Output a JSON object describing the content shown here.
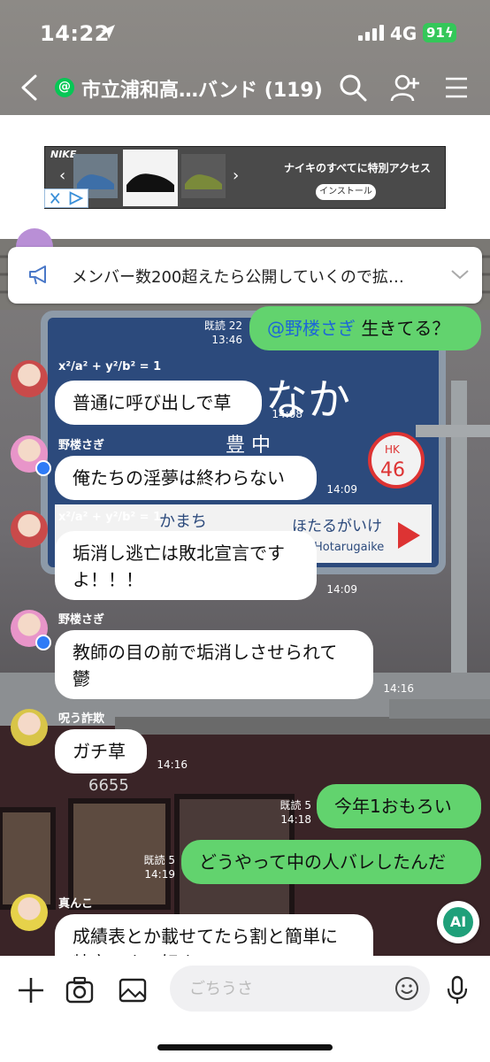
{
  "status": {
    "time": "14:22",
    "network": "4G",
    "battery": "91"
  },
  "header": {
    "group_badge": "@",
    "title": "市立浦和高…バンド (119)"
  },
  "ad": {
    "brand": "NIKE",
    "title": "ナイキのすべてに特別アクセス",
    "install_label": "インストール"
  },
  "announcement": {
    "text": "メンバー数200超えたら公開していくので拡…"
  },
  "messages": [
    {
      "side": "out",
      "text_mention": "@野楼さぎ",
      "text": " 生きてる？",
      "read": "既読 22",
      "time": "13:46"
    },
    {
      "side": "in",
      "sender": "x²/a² + y²/b² = 1",
      "text": "普通に呼び出しで草",
      "time": "14:08"
    },
    {
      "side": "in",
      "sender": "野楼さぎ",
      "text": "俺たちの淫夢は終わらない",
      "time": "14:09"
    },
    {
      "side": "in",
      "sender": "x²/a² + y²/b² = 1",
      "text": "垢消し逃亡は敗北宣言です\nよ！！！",
      "time": "14:09"
    },
    {
      "side": "in",
      "sender": "野楼さぎ",
      "text": "教師の目の前で垢消しさせられて\n鬱",
      "time": "14:16"
    },
    {
      "side": "in",
      "sender": "呪う詐欺",
      "text": "ガチ草",
      "time": "14:16"
    },
    {
      "side": "out",
      "text": "今年1おもろい",
      "read": "既読 5",
      "time": "14:18"
    },
    {
      "side": "out",
      "text": "どうやって中の人バレしたんだ",
      "read": "既読 5",
      "time": "14:19"
    },
    {
      "side": "in",
      "sender": "真んこ",
      "text": "成績表とか載せてたら割と簡単に\n特定できて好き"
    }
  ],
  "ai_button": {
    "label": "AI"
  },
  "input": {
    "placeholder": "ごちうさ"
  },
  "colors": {
    "out_bubble": "#62d36e",
    "mention": "#1c66d8",
    "accent": "#06c755"
  },
  "icons": [
    "location-arrow-icon",
    "signal-icon",
    "back-icon",
    "search-icon",
    "add-friend-icon",
    "menu-icon",
    "megaphone-icon",
    "chevron-down-icon",
    "plus-icon",
    "camera-icon",
    "image-icon",
    "emoji-icon",
    "microphone-icon"
  ]
}
